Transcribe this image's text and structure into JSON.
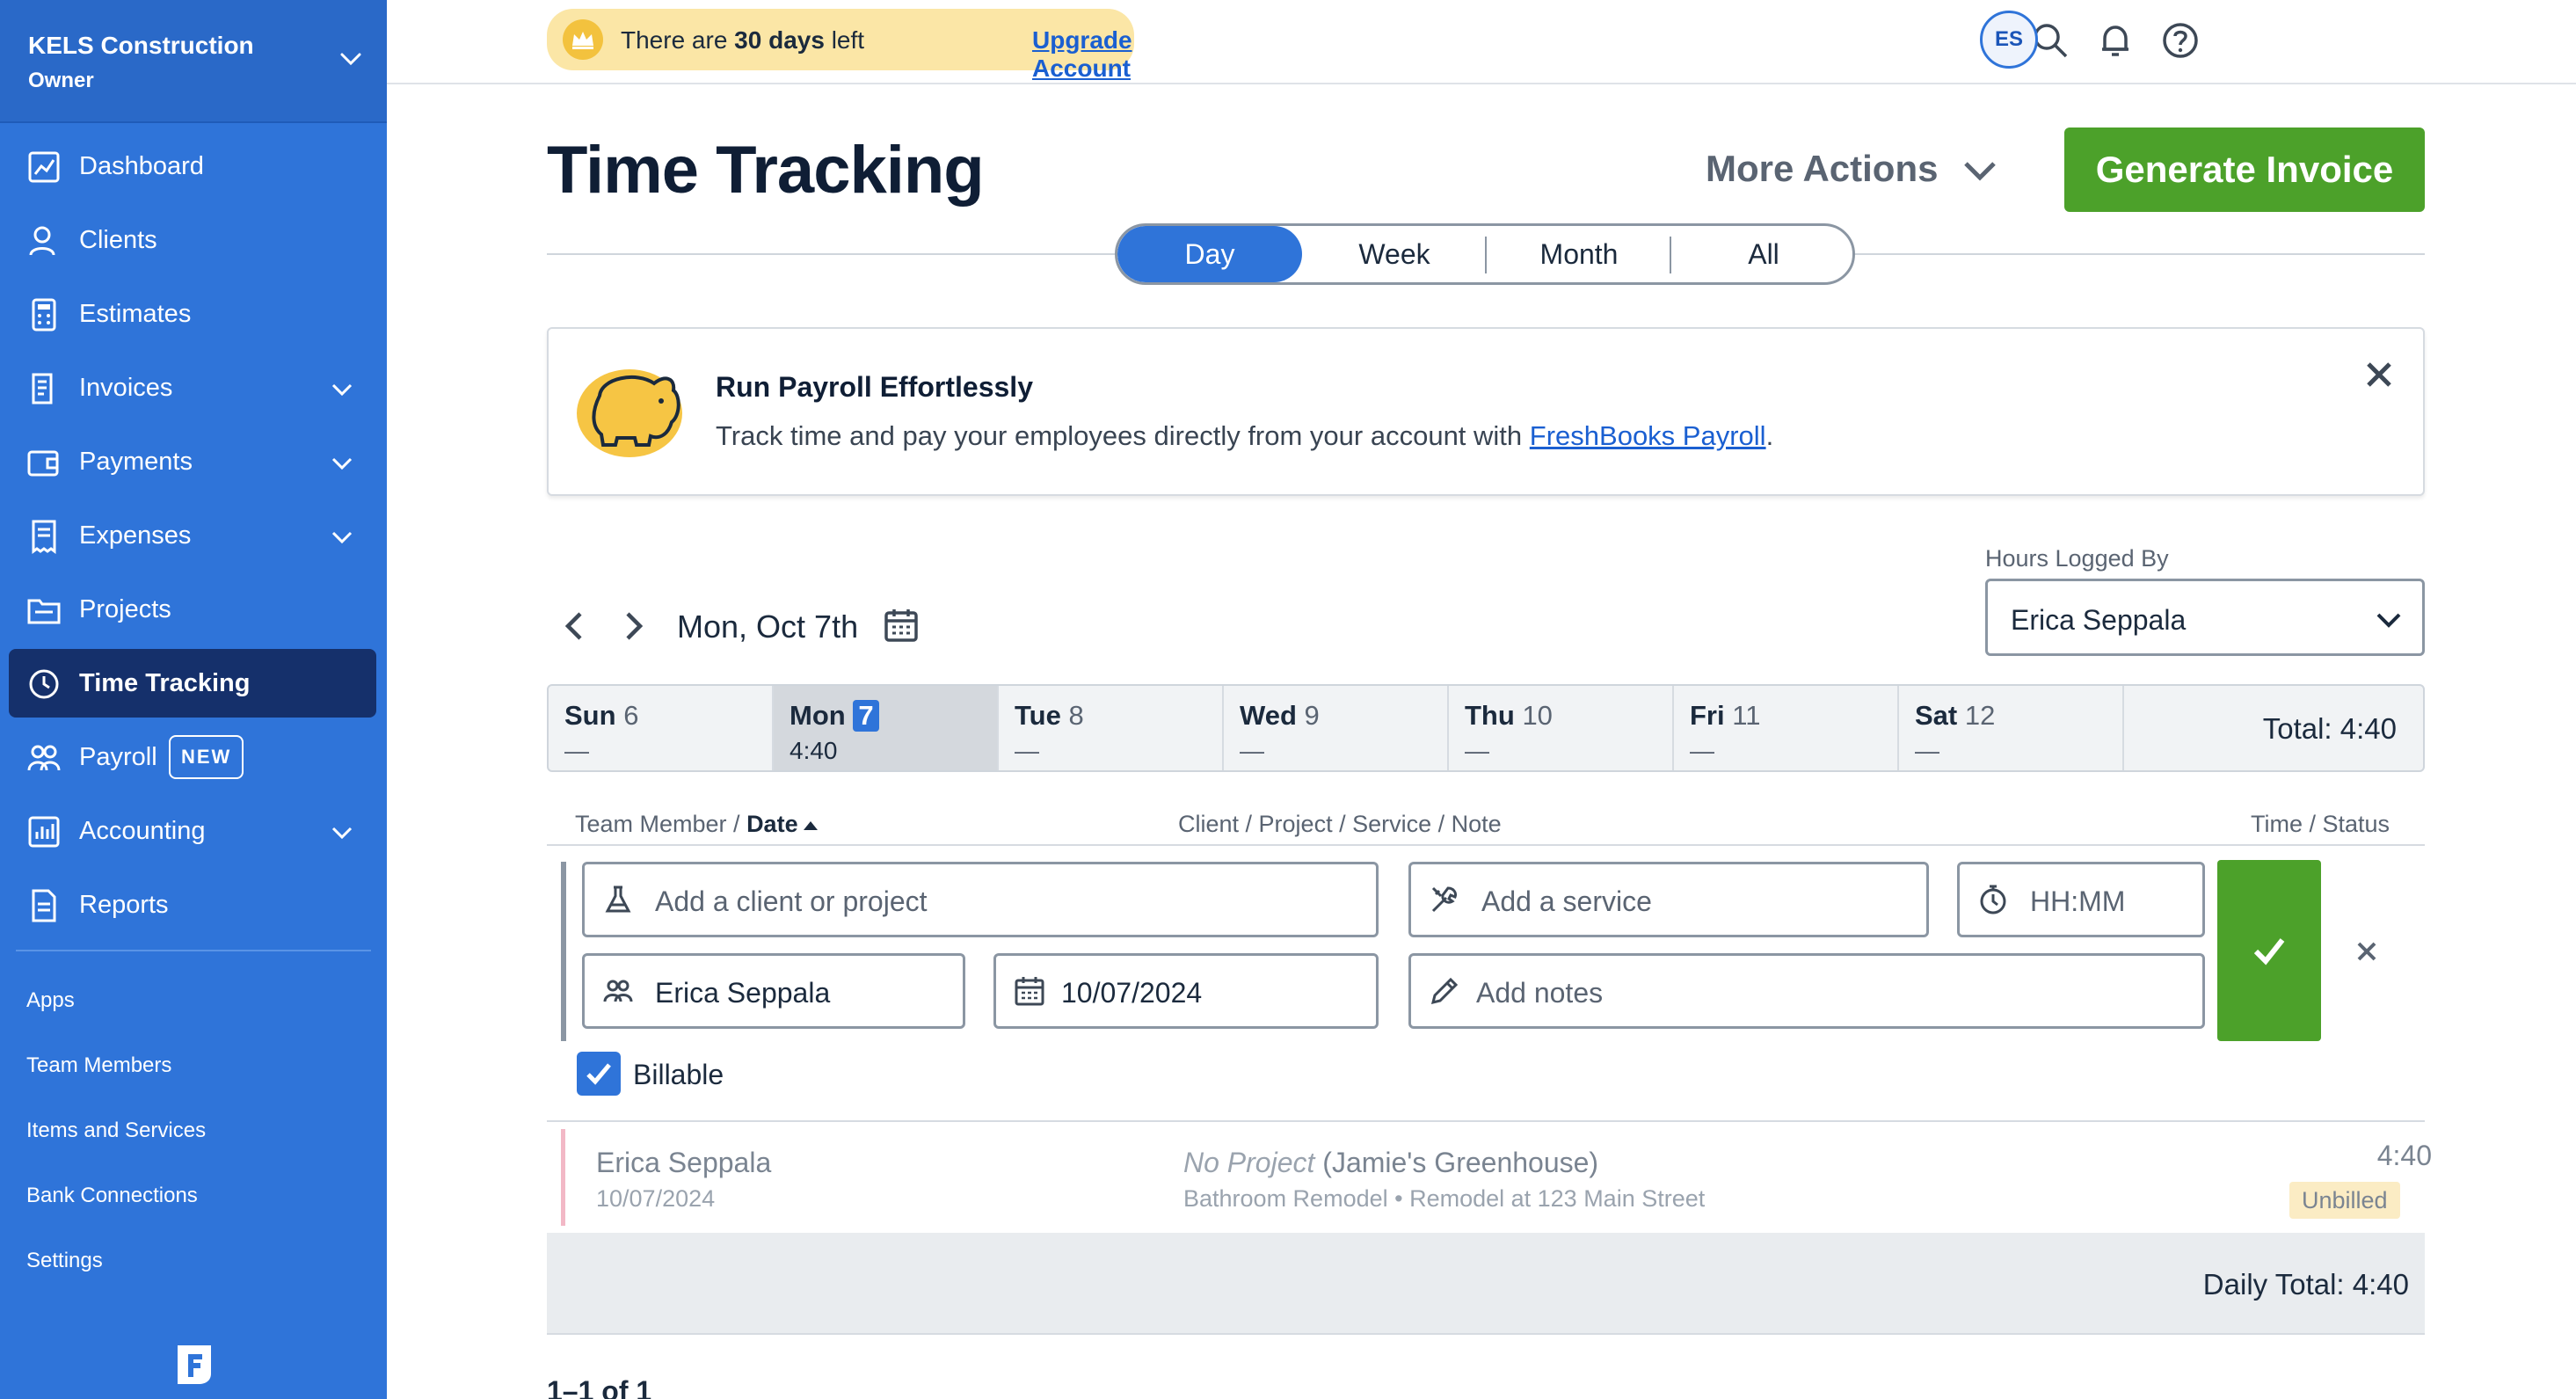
{
  "company": {
    "name": "KELS Construction",
    "role": "Owner"
  },
  "nav": [
    {
      "label": "Dashboard",
      "icon": "chart-icon"
    },
    {
      "label": "Clients",
      "icon": "user-icon"
    },
    {
      "label": "Estimates",
      "icon": "calculator-icon"
    },
    {
      "label": "Invoices",
      "icon": "invoice-icon"
    },
    {
      "label": "Payments",
      "icon": "wallet-icon"
    },
    {
      "label": "Expenses",
      "icon": "receipt-icon"
    },
    {
      "label": "Projects",
      "icon": "folder-icon"
    },
    {
      "label": "Time Tracking",
      "icon": "clock-icon"
    },
    {
      "label": "Payroll",
      "icon": "team-icon",
      "badge": "NEW"
    },
    {
      "label": "Accounting",
      "icon": "bar-chart-icon"
    },
    {
      "label": "Reports",
      "icon": "report-icon"
    }
  ],
  "secondary_nav": [
    "Apps",
    "Team Members",
    "Items and Services",
    "Bank Connections",
    "Settings"
  ],
  "trial": {
    "prefix": "There are ",
    "days": "30 days",
    "suffix": " left",
    "link": "Upgrade Account"
  },
  "user": {
    "initials": "ES"
  },
  "page": {
    "title": "Time Tracking",
    "more_actions": "More Actions",
    "generate_invoice": "Generate Invoice"
  },
  "period_toggle": {
    "options": [
      "Day",
      "Week",
      "Month",
      "All"
    ],
    "selected": "Day"
  },
  "promo": {
    "title": "Run Payroll Effortlessly",
    "body": "Track time and pay your employees directly from your account with ",
    "link": "FreshBooks Payroll",
    "end": "."
  },
  "date_nav": {
    "label": "Mon, Oct 7th"
  },
  "hours_logged_by": {
    "label": "Hours Logged By",
    "value": "Erica Seppala"
  },
  "week": {
    "days": [
      {
        "name": "Sun",
        "num": "6",
        "value": "—"
      },
      {
        "name": "Mon",
        "num": "7",
        "value": "4:40",
        "selected": true
      },
      {
        "name": "Tue",
        "num": "8",
        "value": "—"
      },
      {
        "name": "Wed",
        "num": "9",
        "value": "—"
      },
      {
        "name": "Thu",
        "num": "10",
        "value": "—"
      },
      {
        "name": "Fri",
        "num": "11",
        "value": "—"
      },
      {
        "name": "Sat",
        "num": "12",
        "value": "—"
      }
    ],
    "total": "Total: 4:40"
  },
  "columns": {
    "member": "Team Member / ",
    "date": "Date",
    "client": "Client / Project / Service / Note",
    "time": "Time / Status"
  },
  "entry_form": {
    "client_placeholder": "Add a client or project",
    "service_placeholder": "Add a service",
    "time_placeholder": "HH:MM",
    "member_value": "Erica Seppala",
    "date_value": "10/07/2024",
    "notes_placeholder": "Add notes",
    "billable_label": "Billable"
  },
  "entries": [
    {
      "member": "Erica Seppala",
      "date": "10/07/2024",
      "project": "No Project",
      "client": " (Jamie's Greenhouse)",
      "service": "Bathroom Remodel • Remodel at 123 Main Street",
      "time": "4:40",
      "status": "Unbilled"
    }
  ],
  "daily_total": "Daily Total: 4:40",
  "pagination": "1–1 of 1",
  "colors": {
    "sidebar": "#2f74d9",
    "active_nav": "#15306b",
    "accent_green": "#4ca12a",
    "trial_bg": "#fbe6a6"
  }
}
